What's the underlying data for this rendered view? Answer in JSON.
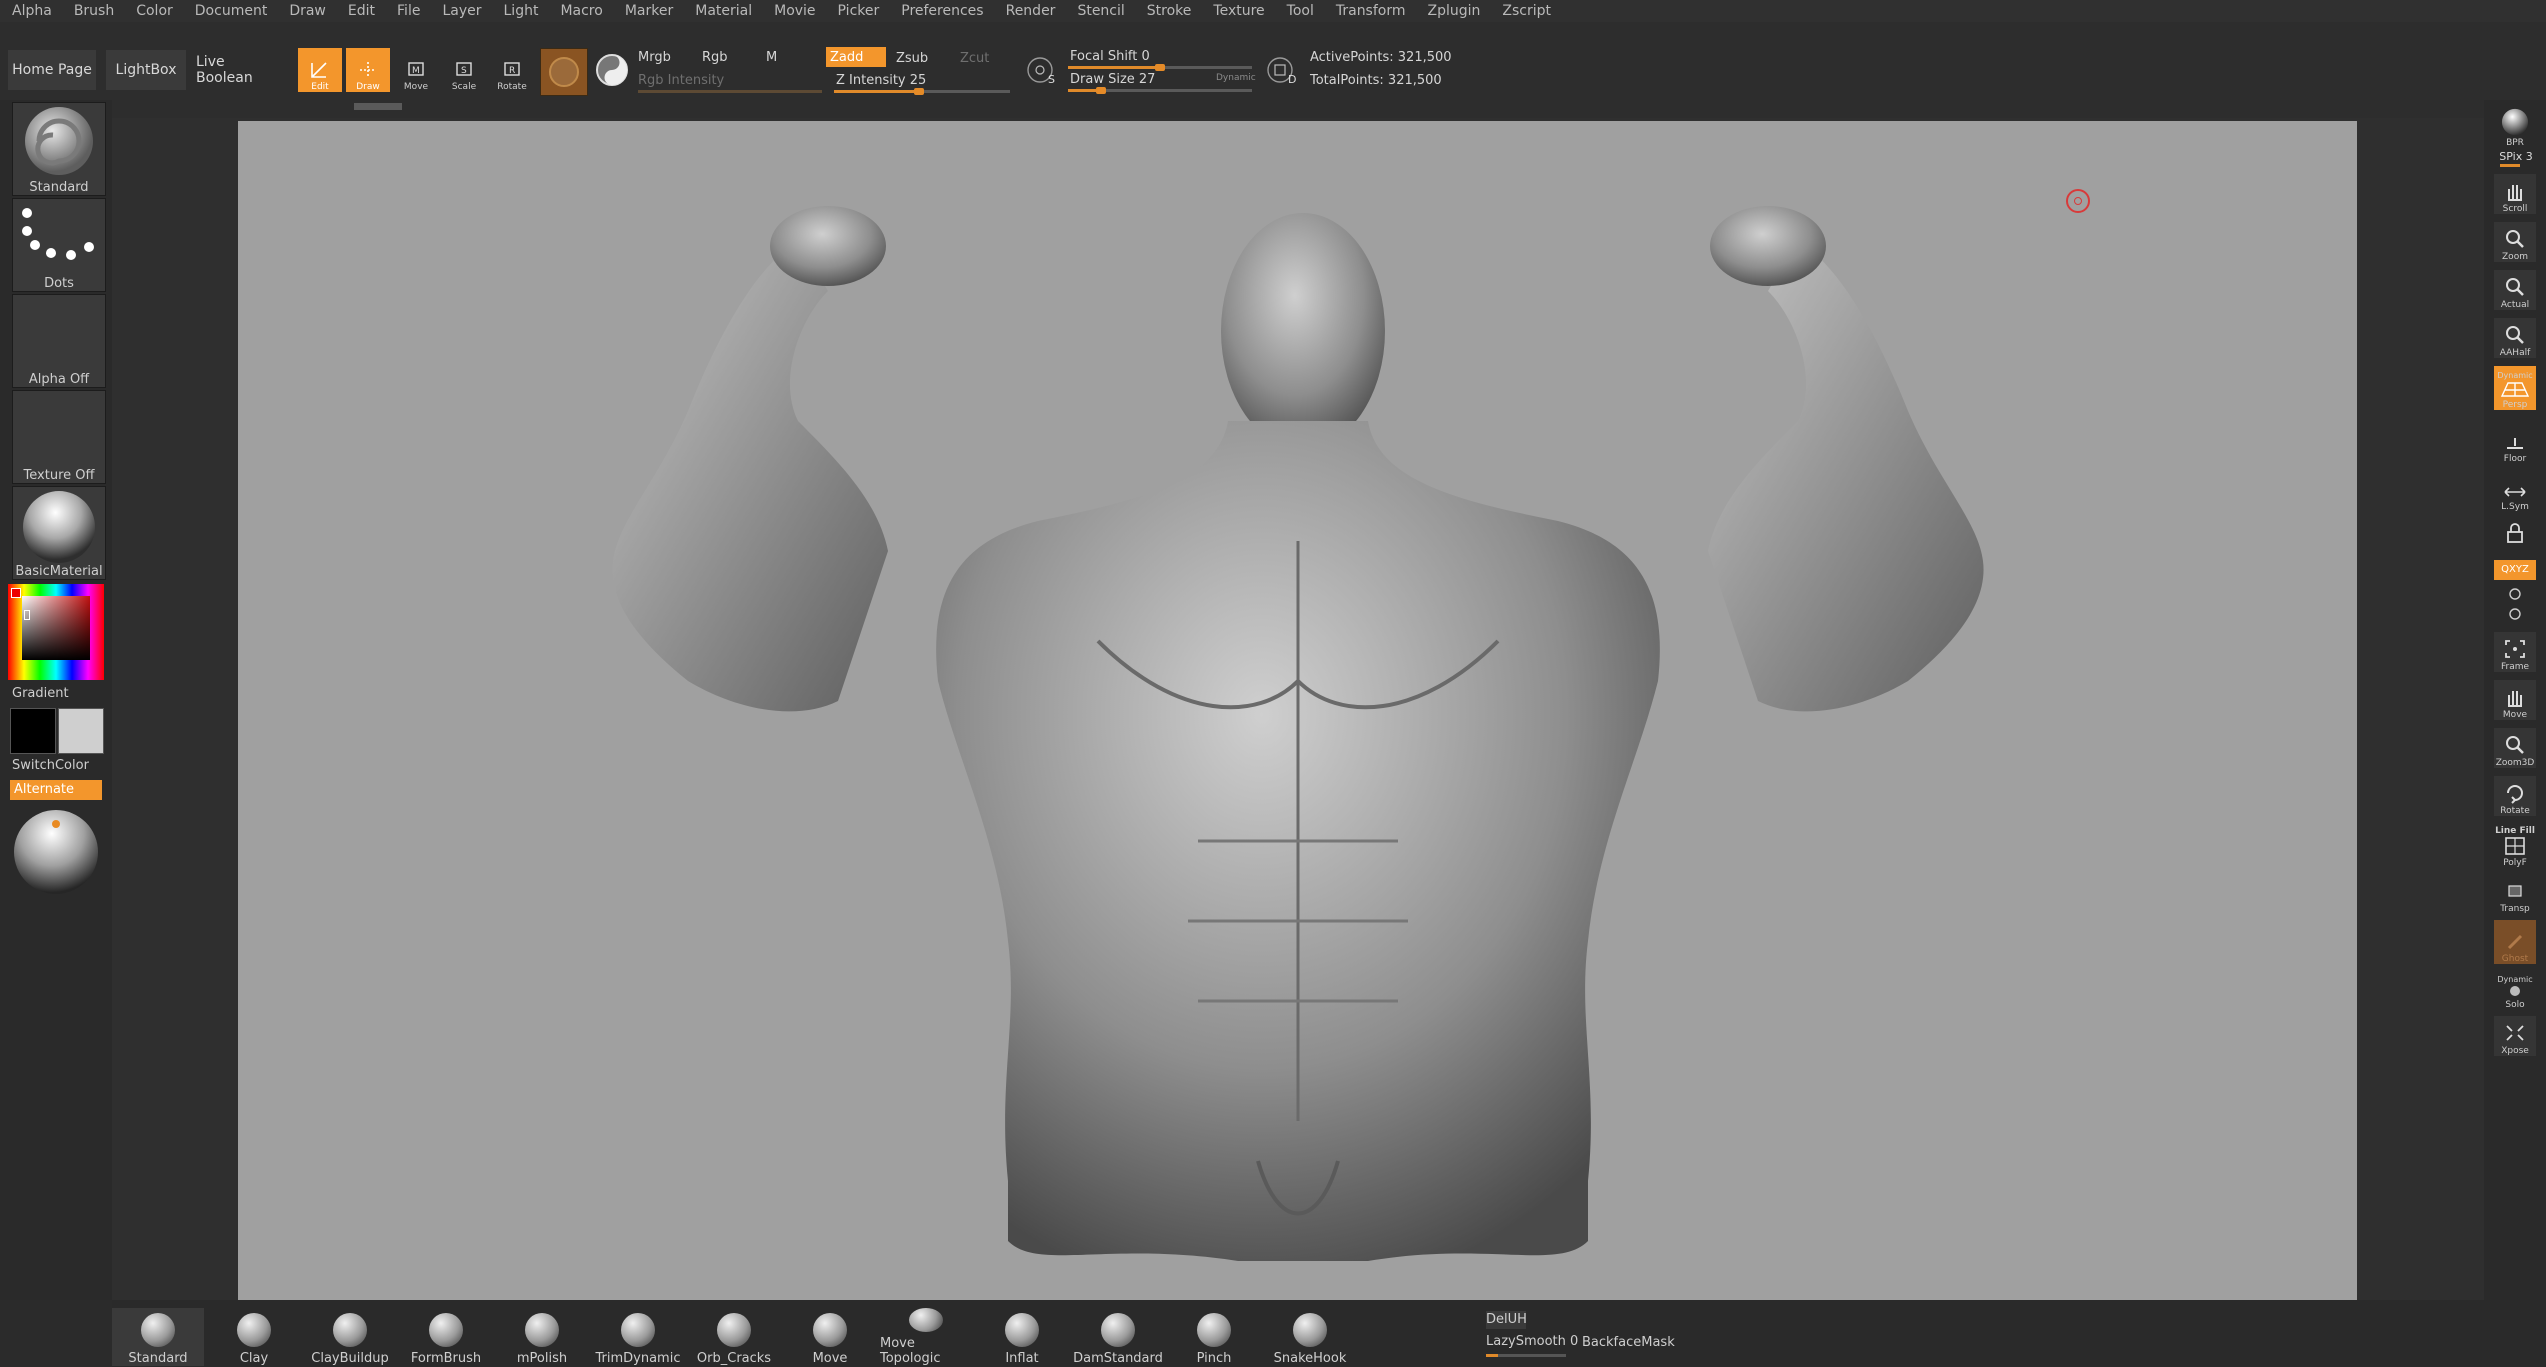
{
  "menu": [
    "Alpha",
    "Brush",
    "Color",
    "Document",
    "Draw",
    "Edit",
    "File",
    "Layer",
    "Light",
    "Macro",
    "Marker",
    "Material",
    "Movie",
    "Picker",
    "Preferences",
    "Render",
    "Stencil",
    "Stroke",
    "Texture",
    "Tool",
    "Transform",
    "Zplugin",
    "Zscript"
  ],
  "toolbar": {
    "home_page": "Home Page",
    "lightbox": "LightBox",
    "live_boolean": "Live Boolean",
    "edit": "Edit",
    "draw": "Draw",
    "move": "Move",
    "scale": "Scale",
    "rotate": "Rotate",
    "mrgb": "Mrgb",
    "rgb": "Rgb",
    "m": "M",
    "rgb_intensity": "Rgb Intensity",
    "zadd": "Zadd",
    "zsub": "Zsub",
    "zcut": "Zcut",
    "z_intensity": "Z Intensity 25",
    "focal_shift": "Focal Shift 0",
    "draw_size": "Draw Size 27",
    "dynamic": "Dynamic",
    "active_points": "ActivePoints: 321,500",
    "total_points": "TotalPoints: 321,500",
    "s_label": "S",
    "d_label": "D"
  },
  "left_panel": {
    "brush": "Standard",
    "stroke": "Dots",
    "alpha": "Alpha Off",
    "texture": "Texture Off",
    "material": "BasicMaterial",
    "gradient": "Gradient",
    "switch_color": "SwitchColor",
    "alternate": "Alternate"
  },
  "right_shelf": {
    "bpr": "BPR",
    "spix": "SPix 3",
    "scroll": "Scroll",
    "zoom": "Zoom",
    "actual": "Actual",
    "aahalf": "AAHalf",
    "persp": "Persp",
    "dynamic_top": "Dynamic",
    "floor": "Floor",
    "lsym": "L.Sym",
    "xyz": "QXYZ",
    "frame": "Frame",
    "move": "Move",
    "zoom3d": "Zoom3D",
    "rotate": "Rotate",
    "line_fill": "Line Fill",
    "polyf": "PolyF",
    "transp": "Transp",
    "ghost": "Ghost",
    "dynamic_solo": "Dynamic",
    "solo": "Solo",
    "xpose": "Xpose"
  },
  "bottom_brushes": [
    "Standard",
    "Clay",
    "ClayBuildup",
    "FormBrush",
    "mPolish",
    "TrimDynamic",
    "Orb_Cracks",
    "Move",
    "Move Topologic",
    "Inflat",
    "DamStandard",
    "Pinch",
    "SnakeHook"
  ],
  "bottom_options": {
    "deluh": "DelUH",
    "lazy_smooth": "LazySmooth 0",
    "backface_mask": "BackfaceMask"
  },
  "colors": {
    "accent": "#f3962c",
    "canvas": "#a0a0a0",
    "ui_bg": "#2b2b2b"
  }
}
